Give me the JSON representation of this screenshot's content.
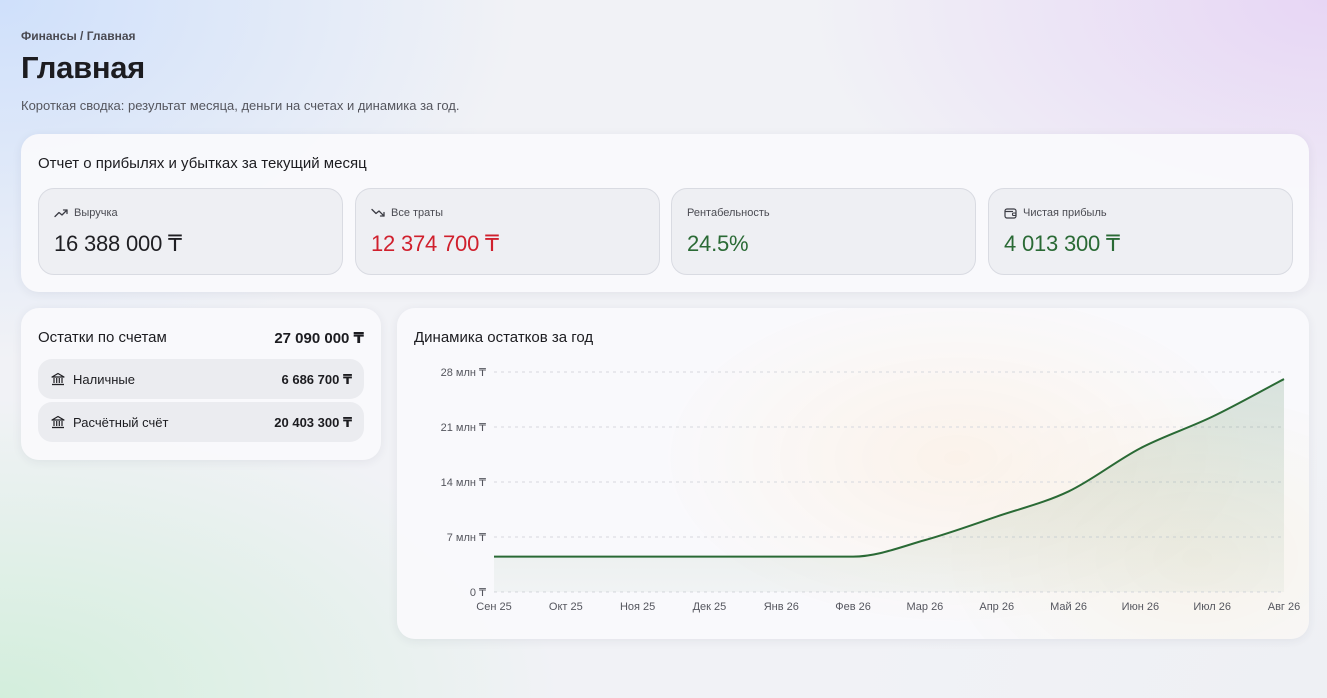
{
  "breadcrumb": "Финансы / Главная",
  "page": {
    "title": "Главная",
    "subtitle": "Короткая сводка: результат месяца, деньги на счетах и динамика за год."
  },
  "pl": {
    "title": "Отчет о прибылях и убытках за текущий месяц",
    "kpis": [
      {
        "label": "Выручка",
        "value": "16 388 000 ₸",
        "icon": "trend-up-icon",
        "color": "#1f1f23"
      },
      {
        "label": "Все траты",
        "value": "12 374 700 ₸",
        "icon": "trend-down-icon",
        "color": "#d0202d"
      },
      {
        "label": "Рентабельность",
        "value": "24.5%",
        "icon": "",
        "color": "#2a6a35"
      },
      {
        "label": "Чистая прибыль",
        "value": "4 013 300 ₸",
        "icon": "wallet-icon",
        "color": "#2a6a35"
      }
    ]
  },
  "accounts": {
    "title": "Остатки по счетам",
    "total": "27 090 000 ₸",
    "items": [
      {
        "name": "Наличные",
        "amount": "6 686 700 ₸",
        "icon": "bank-icon"
      },
      {
        "name": "Расчётный счёт",
        "amount": "20 403 300 ₸",
        "icon": "bank-icon"
      }
    ]
  },
  "chart": {
    "title": "Динамика остатков за год"
  },
  "chart_data": {
    "type": "area",
    "title": "Динамика остатков за год",
    "x": [
      "Сен 25",
      "Окт 25",
      "Ноя 25",
      "Дек 25",
      "Янв 26",
      "Фев 26",
      "Мар 26",
      "Апр 26",
      "Май 26",
      "Июн 26",
      "Июл 26",
      "Авг 26"
    ],
    "values": [
      4.5,
      4.5,
      4.5,
      4.5,
      4.5,
      4.5,
      6.6,
      9.6,
      12.8,
      18.3,
      22.3,
      27.1
    ],
    "unit": "млн ₸",
    "yticks": [
      "0 ₸",
      "7 млн ₸",
      "14 млн ₸",
      "21 млн ₸",
      "28 млн ₸"
    ],
    "ytick_values": [
      0,
      7,
      14,
      21,
      28
    ],
    "ylim": [
      0,
      28
    ],
    "grid": true,
    "legend": "none",
    "line_color": "#2a6a35",
    "fill_color": "#2a6a35"
  },
  "colors": {
    "accent_green": "#2a6a35",
    "negative_red": "#d0202d"
  }
}
